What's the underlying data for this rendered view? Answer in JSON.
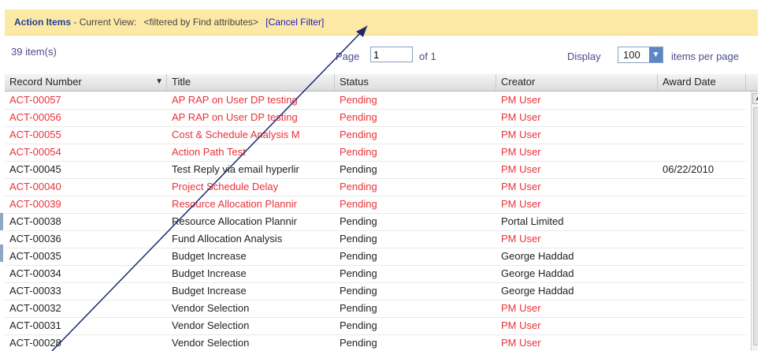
{
  "banner": {
    "title": "Action Items",
    "separator": " - ",
    "current_view_label": "Current View:",
    "filter_text": "<filtered by Find attributes>",
    "cancel_filter": "[Cancel Filter]"
  },
  "toolbar": {
    "item_count": "39 item(s)",
    "page_label": "Page",
    "page_value": "1",
    "of_label": "of 1",
    "display_label": "Display",
    "display_value": "100",
    "items_per_page_label": "items per page"
  },
  "table": {
    "columns": [
      "Record Number",
      "Title",
      "Status",
      "Creator",
      "Award Date"
    ],
    "rows": [
      {
        "record": "ACT-00057",
        "title": "AP RAP on User DP testing",
        "status": "Pending",
        "creator": "PM User",
        "award": "",
        "color": "red"
      },
      {
        "record": "ACT-00056",
        "title": "AP RAP on User DP testing",
        "status": "Pending",
        "creator": "PM User",
        "award": "",
        "color": "red"
      },
      {
        "record": "ACT-00055",
        "title": "Cost & Schedule Analysis M",
        "status": "Pending",
        "creator": "PM User",
        "award": "",
        "color": "red"
      },
      {
        "record": "ACT-00054",
        "title": "Action Path Test",
        "status": "Pending",
        "creator": "PM User",
        "award": "",
        "color": "red"
      },
      {
        "record": "ACT-00045",
        "title": "Test Reply via email hyperlir",
        "status": "Pending",
        "creator": "PM User",
        "award": "06/22/2010",
        "color": "black"
      },
      {
        "record": "ACT-00040",
        "title": "Project Schedule Delay",
        "status": "Pending",
        "creator": "PM User",
        "award": "",
        "color": "red"
      },
      {
        "record": "ACT-00039",
        "title": "Resource Allocation Plannir",
        "status": "Pending",
        "creator": "PM User",
        "award": "",
        "color": "red"
      },
      {
        "record": "ACT-00038",
        "title": "Resource Allocation Plannir",
        "status": "Pending",
        "creator": "Portal Limited",
        "award": "",
        "color": "black"
      },
      {
        "record": "ACT-00036",
        "title": "Fund Allocation Analysis",
        "status": "Pending",
        "creator": "PM User",
        "award": "",
        "color": "black"
      },
      {
        "record": "ACT-00035",
        "title": "Budget Increase",
        "status": "Pending",
        "creator": "George Haddad",
        "award": "",
        "color": "black"
      },
      {
        "record": "ACT-00034",
        "title": "Budget Increase",
        "status": "Pending",
        "creator": "George Haddad",
        "award": "",
        "color": "black"
      },
      {
        "record": "ACT-00033",
        "title": "Budget Increase",
        "status": "Pending",
        "creator": "George Haddad",
        "award": "",
        "color": "black"
      },
      {
        "record": "ACT-00032",
        "title": "Vendor Selection",
        "status": "Pending",
        "creator": "PM User",
        "award": "",
        "color": "black"
      },
      {
        "record": "ACT-00031",
        "title": "Vendor Selection",
        "status": "Pending",
        "creator": "PM User",
        "award": "",
        "color": "black"
      },
      {
        "record": "ACT-00028",
        "title": "Vendor Selection",
        "status": "Pending",
        "creator": "PM User",
        "award": "",
        "color": "black"
      }
    ]
  },
  "colors": {
    "banner_bg": "#fde9a6",
    "title_blue": "#1f3f8f",
    "link_blue": "#1a1ac8",
    "red_text": "#e8333a",
    "arrow": "#1b2a6b"
  },
  "icons": {
    "sort": "sort-desc-icon",
    "dropdown": "chevron-down-icon",
    "scroll_up": "scroll-up-icon"
  }
}
